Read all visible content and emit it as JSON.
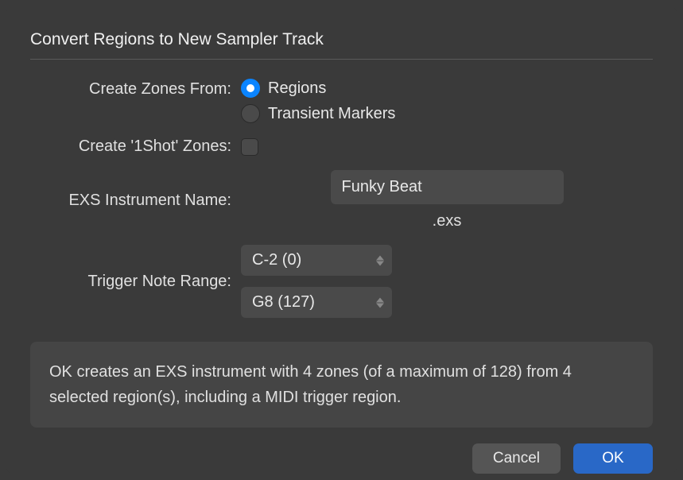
{
  "title": "Convert Regions to New Sampler Track",
  "labels": {
    "createZonesFrom": "Create Zones From:",
    "create1ShotZones": "Create '1Shot' Zones:",
    "exsInstrumentName": "EXS Instrument Name:",
    "triggerNoteRange": "Trigger Note Range:"
  },
  "radioOptions": {
    "regions": "Regions",
    "transientMarkers": "Transient Markers",
    "selected": "regions"
  },
  "checkbox1Shot": false,
  "instrumentName": "Funky Beat",
  "extension": ".exs",
  "triggerRange": {
    "low": "C-2  (0)",
    "high": "G8   (127)"
  },
  "infoText": "OK creates an EXS instrument with 4 zones (of a maximum of 128) from 4 selected region(s), including a MIDI trigger region.",
  "buttons": {
    "cancel": "Cancel",
    "ok": "OK"
  }
}
